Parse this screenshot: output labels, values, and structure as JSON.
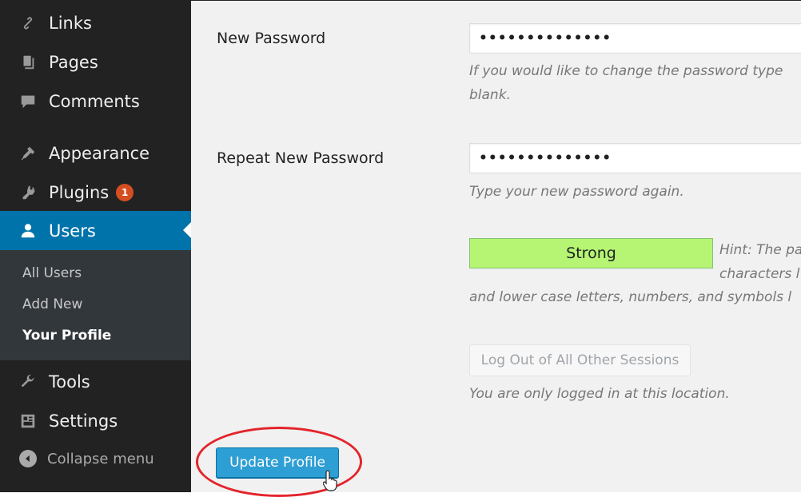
{
  "sidebar": {
    "items": [
      {
        "label": "Links",
        "icon": "links-icon"
      },
      {
        "label": "Pages",
        "icon": "pages-icon"
      },
      {
        "label": "Comments",
        "icon": "comments-icon"
      },
      {
        "label": "Appearance",
        "icon": "appearance-icon"
      },
      {
        "label": "Plugins",
        "icon": "plugins-icon",
        "badge": "1"
      },
      {
        "label": "Users",
        "icon": "users-icon",
        "active": true
      },
      {
        "label": "Tools",
        "icon": "tools-icon"
      },
      {
        "label": "Settings",
        "icon": "settings-icon"
      }
    ],
    "submenu": [
      {
        "label": "All Users"
      },
      {
        "label": "Add New"
      },
      {
        "label": "Your Profile",
        "current": true
      }
    ],
    "collapse_label": "Collapse menu"
  },
  "form": {
    "new_password": {
      "label": "New Password",
      "value": "••••••••••••••",
      "desc_line1": "If you would like to change the password type",
      "desc_line2": "blank."
    },
    "repeat_password": {
      "label": "Repeat New Password",
      "value": "••••••••••••••",
      "desc": "Type your new password again."
    },
    "strength": {
      "label": "Strong",
      "hint_line1": "Hint: The pa",
      "hint_line2": "characters l",
      "hint_line3": "and lower case letters, numbers, and symbols l"
    },
    "sessions": {
      "button_label": "Log Out of All Other Sessions",
      "desc": "You are only logged in at this location."
    },
    "update_button_label": "Update Profile"
  },
  "colors": {
    "sidebar_bg": "#222222",
    "active_bg": "#0073aa",
    "badge_bg": "#d54e21",
    "strength_bg": "#b5f573",
    "primary_button": "#2e9fd4",
    "annotation": "#e3242b"
  }
}
